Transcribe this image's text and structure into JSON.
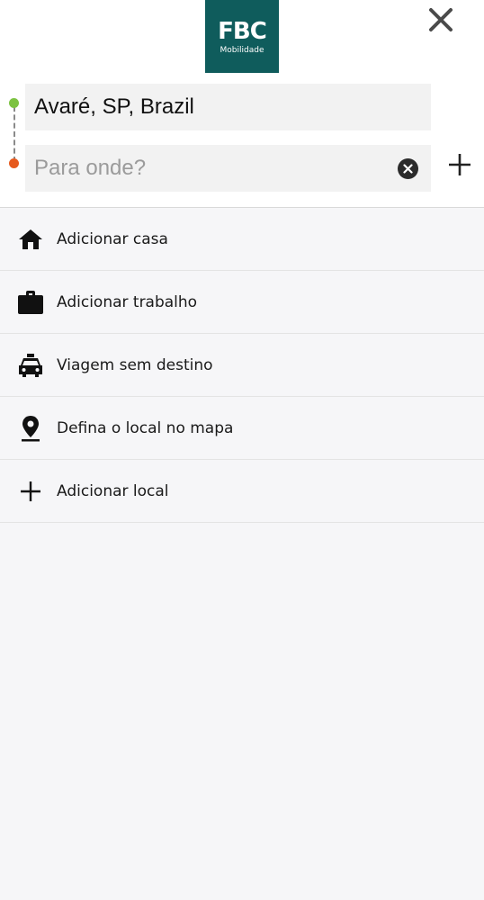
{
  "brand": {
    "mark": "FBC",
    "sub": "Mobilidade",
    "color": "#0f5c5c"
  },
  "header": {
    "close_icon": "close-icon"
  },
  "route": {
    "origin_value": "Avaré, SP, Brazil",
    "destination_placeholder": "Para onde?",
    "origin_dot_color": "#7cc242",
    "destination_dot_color": "#e65a1e"
  },
  "options": [
    {
      "label": "Adicionar casa",
      "icon": "home-icon"
    },
    {
      "label": "Adicionar trabalho",
      "icon": "briefcase-icon"
    },
    {
      "label": "Viagem sem destino",
      "icon": "taxi-icon"
    },
    {
      "label": "Defina o local no mapa",
      "icon": "map-pin-icon"
    },
    {
      "label": "Adicionar local",
      "icon": "plus-icon"
    }
  ]
}
